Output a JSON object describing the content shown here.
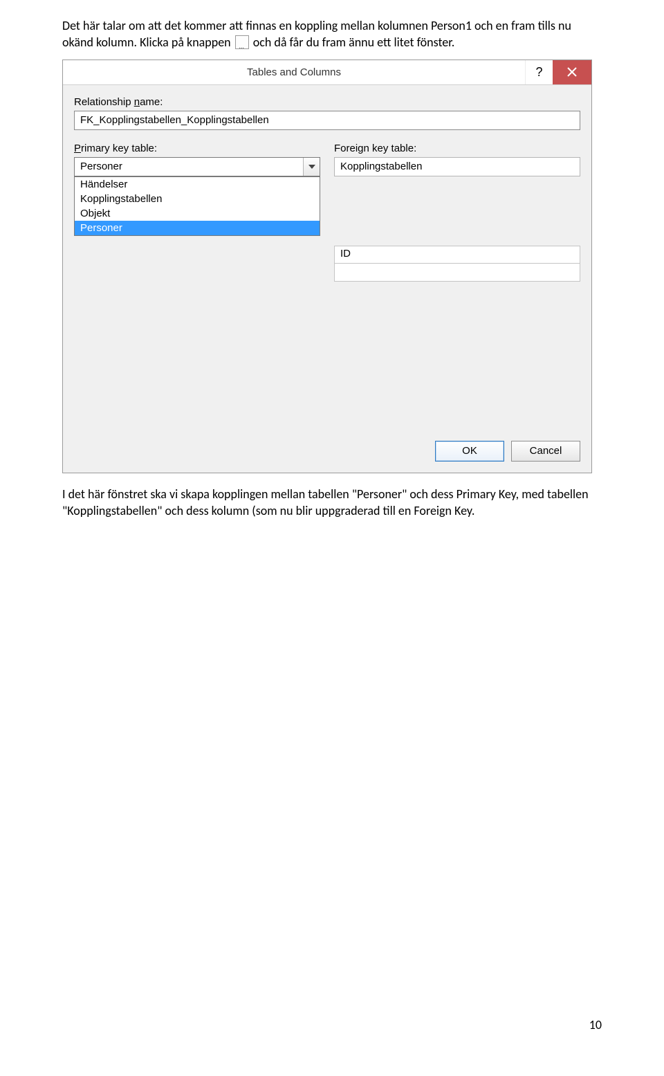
{
  "doc": {
    "para1_part1": "Det här talar om att det kommer att finnas en koppling mellan kolumnen Person1 och en fram tills nu okänd kolumn. Klicka på knappen ",
    "para1_part2": " och då får du fram ännu ett litet fönster.",
    "para2": "I det här fönstret ska vi skapa kopplingen mellan tabellen \"Personer\" och dess Primary Key, med tabellen \"Kopplingstabellen\" och dess kolumn (som nu blir uppgraderad till en Foreign Key.",
    "page_number": "10"
  },
  "dialog": {
    "title": "Tables and Columns",
    "labels": {
      "relationship_name_prefix": "Relationship ",
      "relationship_name_accel": "n",
      "relationship_name_suffix": "ame:",
      "primary_key_table_accel": "P",
      "primary_key_table_suffix": "rimary key table:",
      "foreign_key_table": "Foreign key table:"
    },
    "relationship_name_value": "FK_Kopplingstabellen_Kopplingstabellen",
    "primary_key_table_selected": "Personer",
    "primary_key_table_options": [
      {
        "label": "Händelser",
        "selected": false
      },
      {
        "label": "Kopplingstabellen",
        "selected": false
      },
      {
        "label": "Objekt",
        "selected": false
      },
      {
        "label": "Personer",
        "selected": true
      }
    ],
    "foreign_key_table_value": "Kopplingstabellen",
    "mapping": {
      "left_row1": "",
      "right_row1": "ID",
      "left_row2": "",
      "right_row2": ""
    },
    "buttons": {
      "ok": "OK",
      "cancel": "Cancel"
    }
  }
}
